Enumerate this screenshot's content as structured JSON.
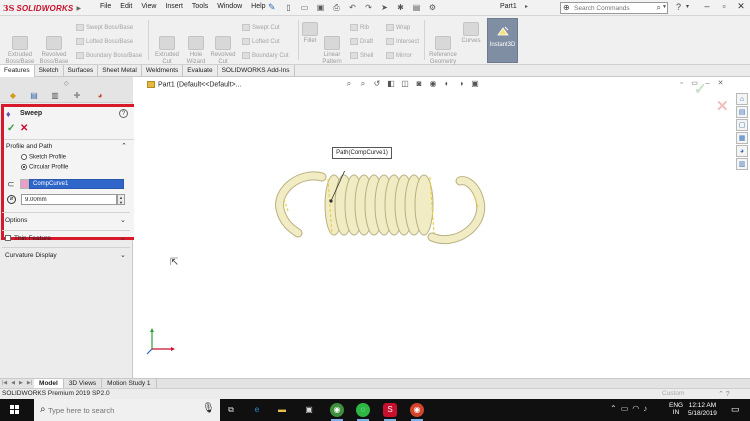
{
  "app": {
    "logo_prefix": "3S",
    "logo_name": "SOLIDWORKS",
    "document_title": "Part1"
  },
  "menu": [
    "File",
    "Edit",
    "View",
    "Insert",
    "Tools",
    "Window",
    "Help"
  ],
  "search": {
    "placeholder": "Search Commands"
  },
  "ribbon": {
    "extruded_boss": "Extruded\nBoss/Base",
    "revolved_boss": "Revolved\nBoss/Base",
    "swept_boss": "Swept Boss/Base",
    "lofted_boss": "Lofted Boss/Base",
    "boundary_boss": "Boundary Boss/Base",
    "extruded_cut": "Extruded\nCut",
    "hole_wizard": "Hole\nWizard",
    "revolved_cut": "Revolved\nCut",
    "swept_cut": "Swept Cut",
    "lofted_cut": "Lofted Cut",
    "boundary_cut": "Boundary Cut",
    "fillet": "Fillet",
    "linear_pattern": "Linear\nPattern",
    "rib": "Rib",
    "draft": "Draft",
    "shell": "Shell",
    "wrap": "Wrap",
    "intersect": "Intersect",
    "mirror": "Mirror",
    "reference_geometry": "Reference\nGeometry",
    "curves": "Curves",
    "instant3d": "Instant3D"
  },
  "command_tabs": [
    "Features",
    "Sketch",
    "Surfaces",
    "Sheet Metal",
    "Weldments",
    "Evaluate",
    "SOLIDWORKS Add-Ins"
  ],
  "sweep_panel": {
    "title": "Sweep",
    "help": "?",
    "ok": "✓",
    "cancel": "✕",
    "section_title": "Profile and Path",
    "radio_sketch": "Sketch Profile",
    "radio_circular": "Circular Profile",
    "path_value": "CompCurve1",
    "diameter_value": "9.00mm"
  },
  "groups": {
    "options": "Options",
    "thin_feature": "Thin Feature",
    "curvature_display": "Curvature Display"
  },
  "graphics": {
    "tree_item": "Part1  (Default<<Default>...",
    "callout": "Path(CompCurve1)"
  },
  "bottom_tabs": [
    "Model",
    "3D Views",
    "Motion Study 1"
  ],
  "status": {
    "text": "SOLIDWORKS Premium 2019 SP2.0",
    "custom": "Custom"
  },
  "taskbar": {
    "search_placeholder": "Type here to search",
    "lang_line1": "ENG",
    "lang_line2": "IN",
    "time": "12:12 AM",
    "date": "5/18/2019"
  },
  "colors": {
    "highlight_border": "#d7192b",
    "selection_fill": "#2f66c9",
    "spring_fill": "#f1ecc4",
    "spring_edge": "#b9b081"
  }
}
